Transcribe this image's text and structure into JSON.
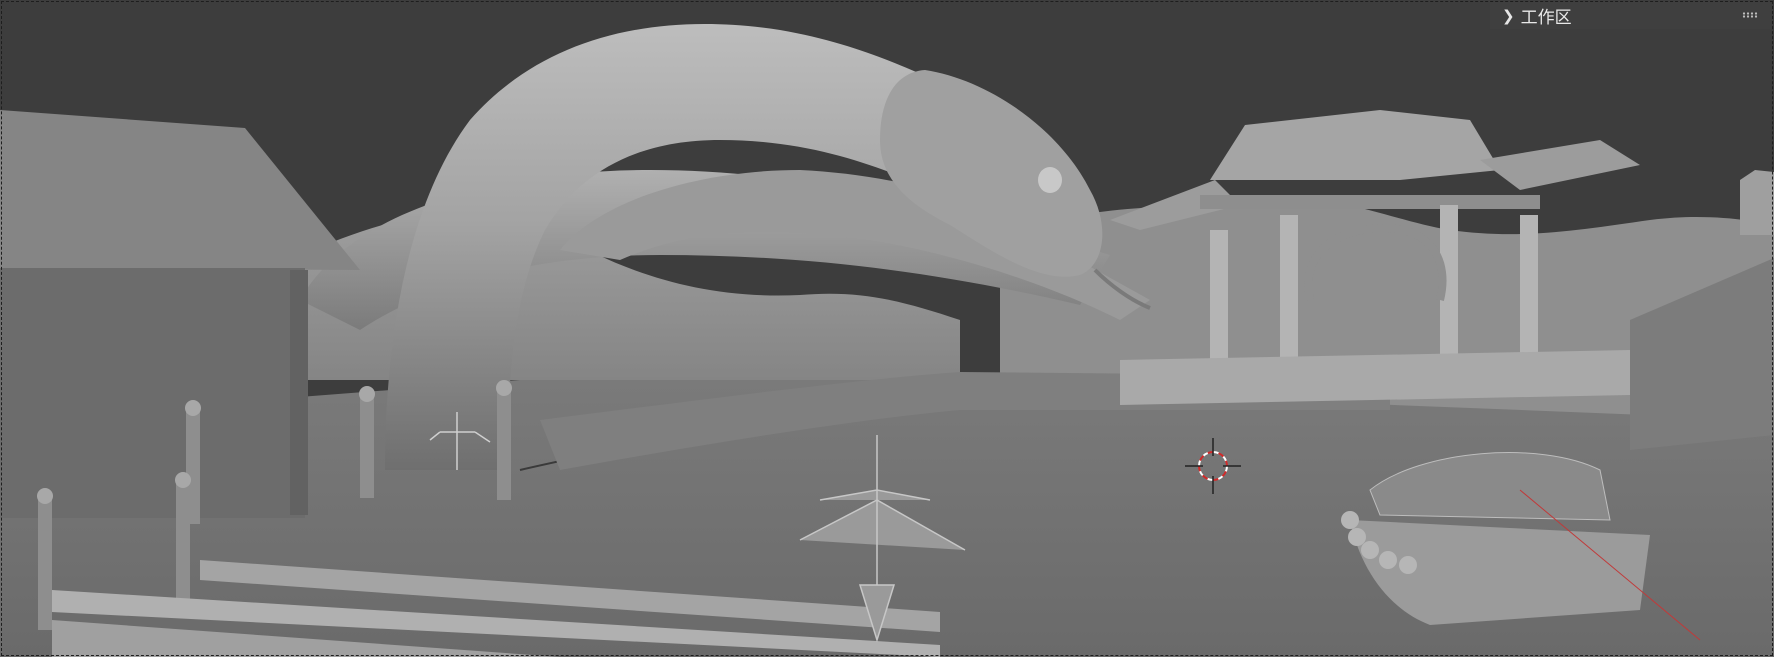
{
  "workspace_panel": {
    "title": "工作区",
    "chevron_icon": "chevron-right-icon",
    "grip_icon": "drag-grip-icon"
  },
  "viewport": {
    "background": "#3d3d3d",
    "solid_gray": "#8a8a8a",
    "cursor_red": "#d22a2a"
  }
}
